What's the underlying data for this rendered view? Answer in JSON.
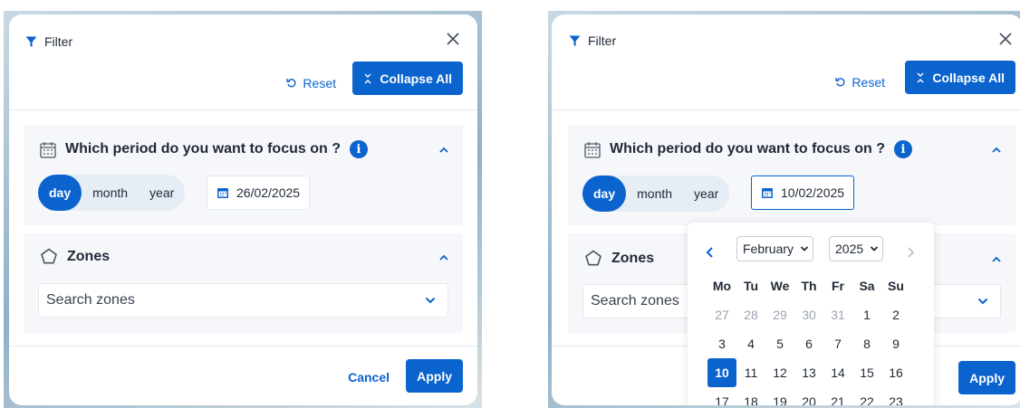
{
  "left": {
    "title": "Filter",
    "reset_label": "Reset",
    "collapse_label": "Collapse All",
    "period_title": "Which period do you want to focus on ?",
    "info_glyph": "i",
    "periods": [
      "day",
      "month",
      "year"
    ],
    "active_period": "day",
    "date_value": "26/02/2025",
    "zones_title": "Zones",
    "zones_placeholder": "Search zones",
    "cancel_label": "Cancel",
    "apply_label": "Apply"
  },
  "right": {
    "title": "Filter",
    "reset_label": "Reset",
    "collapse_label": "Collapse All",
    "period_title": "Which period do you want to focus on ?",
    "info_glyph": "i",
    "periods": [
      "day",
      "month",
      "year"
    ],
    "active_period": "day",
    "date_value": "10/02/2025",
    "zones_title": "Zones",
    "zones_placeholder": "Search zones",
    "apply_label": "Apply",
    "calendar": {
      "month": "February",
      "year": "2025",
      "weekdays": [
        "Mo",
        "Tu",
        "We",
        "Th",
        "Fr",
        "Sa",
        "Su"
      ],
      "days": [
        {
          "d": "27",
          "muted": true
        },
        {
          "d": "28",
          "muted": true
        },
        {
          "d": "29",
          "muted": true
        },
        {
          "d": "30",
          "muted": true
        },
        {
          "d": "31",
          "muted": true
        },
        {
          "d": "1"
        },
        {
          "d": "2"
        },
        {
          "d": "3"
        },
        {
          "d": "4"
        },
        {
          "d": "5"
        },
        {
          "d": "6"
        },
        {
          "d": "7"
        },
        {
          "d": "8"
        },
        {
          "d": "9"
        },
        {
          "d": "10",
          "selected": true
        },
        {
          "d": "11"
        },
        {
          "d": "12"
        },
        {
          "d": "13"
        },
        {
          "d": "14"
        },
        {
          "d": "15"
        },
        {
          "d": "16"
        },
        {
          "d": "17"
        },
        {
          "d": "18"
        },
        {
          "d": "19"
        },
        {
          "d": "20"
        },
        {
          "d": "21"
        },
        {
          "d": "22"
        },
        {
          "d": "23"
        }
      ]
    }
  },
  "colors": {
    "accent": "#0b63ce",
    "section_bg": "#f5f7fa",
    "muted": "#9ca3af"
  }
}
